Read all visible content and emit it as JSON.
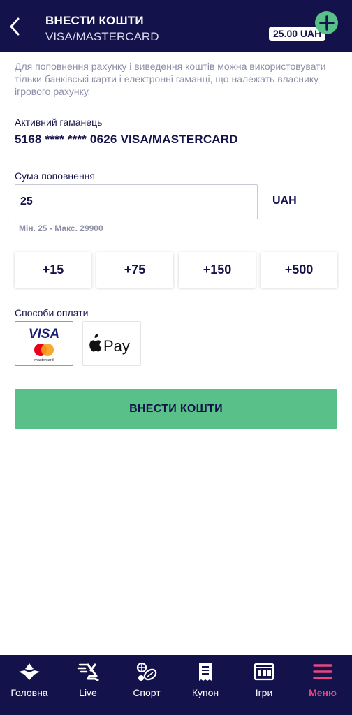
{
  "header": {
    "title": "ВНЕСТИ КОШТИ",
    "subtitle": "VISA/MASTERCARD",
    "balance": "25.00 UAH"
  },
  "info_text": "Для поповнення рахунку і виведення коштів можна використовувати тільки банківські карти і електронні гаманці, що належать власнику ігрового рахунку.",
  "wallet": {
    "label": "Активний гаманець",
    "value": "5168 **** **** 0626 VISA/MASTERCARD"
  },
  "amount": {
    "label": "Сума поповнення",
    "value": "25",
    "currency": "UAH",
    "limits": "Мін. 25 - Макс. 29900"
  },
  "quick_amounts": [
    "+15",
    "+75",
    "+150",
    "+500"
  ],
  "payment_methods": {
    "label": "Способи оплати",
    "visa_text": "VISA",
    "mastercard_text": "mastercard",
    "applepay_text": "Pay"
  },
  "submit_label": "ВНЕСТИ КОШТИ",
  "nav": {
    "items": [
      {
        "label": "Головна",
        "icon": "home-logo-icon"
      },
      {
        "label": "Live",
        "icon": "live-icon"
      },
      {
        "label": "Спорт",
        "icon": "sport-icon"
      },
      {
        "label": "Купон",
        "icon": "coupon-icon"
      },
      {
        "label": "Ігри",
        "icon": "games-icon"
      },
      {
        "label": "Меню",
        "icon": "menu-icon"
      }
    ],
    "active": "Меню"
  },
  "colors": {
    "brand_navy": "#14124a",
    "accent_green": "#5ac08a",
    "active_pink": "#e8467c"
  }
}
